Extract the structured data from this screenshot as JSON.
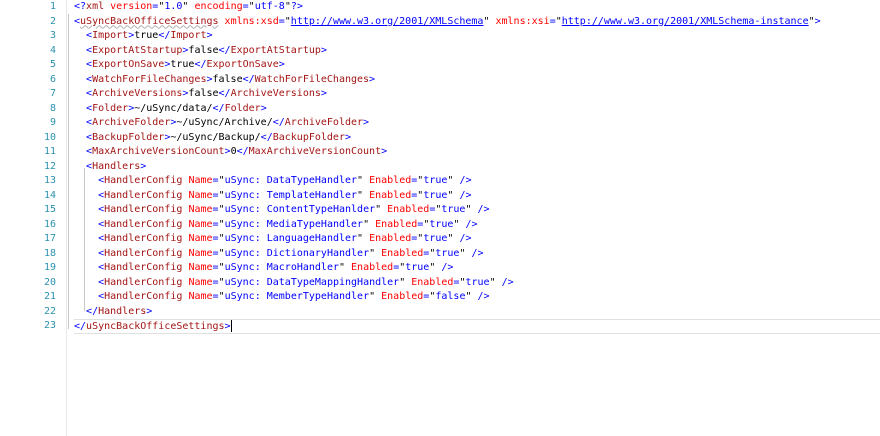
{
  "editor": {
    "line_numbers": [
      "1",
      "2",
      "3",
      "4",
      "5",
      "6",
      "7",
      "8",
      "9",
      "10",
      "11",
      "12",
      "13",
      "14",
      "15",
      "16",
      "17",
      "18",
      "19",
      "20",
      "21",
      "22",
      "23"
    ],
    "lines": [
      [
        {
          "c": "b",
          "t": "<?"
        },
        {
          "c": "n",
          "t": "xml"
        },
        {
          "c": "t",
          "t": " "
        },
        {
          "c": "a",
          "t": "version"
        },
        {
          "c": "b",
          "t": "="
        },
        {
          "c": "t",
          "t": "\""
        },
        {
          "c": "v",
          "t": "1.0"
        },
        {
          "c": "t",
          "t": "\" "
        },
        {
          "c": "a",
          "t": "encoding"
        },
        {
          "c": "b",
          "t": "="
        },
        {
          "c": "t",
          "t": "\""
        },
        {
          "c": "v",
          "t": "utf-8"
        },
        {
          "c": "t",
          "t": "\""
        },
        {
          "c": "b",
          "t": "?>"
        }
      ],
      [
        {
          "c": "b",
          "t": "<"
        },
        {
          "c": "n",
          "t": "uSyncBackOfficeSettings",
          "squig": true
        },
        {
          "c": "t",
          "t": " "
        },
        {
          "c": "a",
          "t": "xmlns:xsd"
        },
        {
          "c": "b",
          "t": "="
        },
        {
          "c": "t",
          "t": "\""
        },
        {
          "c": "u",
          "t": "http://www.w3.org/2001/XMLSchema"
        },
        {
          "c": "t",
          "t": "\" "
        },
        {
          "c": "a",
          "t": "xmlns:xsi"
        },
        {
          "c": "b",
          "t": "="
        },
        {
          "c": "t",
          "t": "\""
        },
        {
          "c": "u",
          "t": "http://www.w3.org/2001/XMLSchema-instance"
        },
        {
          "c": "t",
          "t": "\""
        },
        {
          "c": "b",
          "t": ">"
        }
      ],
      [
        {
          "c": "t",
          "t": "  "
        },
        {
          "c": "b",
          "t": "<"
        },
        {
          "c": "n",
          "t": "Import"
        },
        {
          "c": "b",
          "t": ">"
        },
        {
          "c": "t",
          "t": "true"
        },
        {
          "c": "b",
          "t": "</"
        },
        {
          "c": "n",
          "t": "Import"
        },
        {
          "c": "b",
          "t": ">"
        }
      ],
      [
        {
          "c": "t",
          "t": "  "
        },
        {
          "c": "b",
          "t": "<"
        },
        {
          "c": "n",
          "t": "ExportAtStartup"
        },
        {
          "c": "b",
          "t": ">"
        },
        {
          "c": "t",
          "t": "false"
        },
        {
          "c": "b",
          "t": "</"
        },
        {
          "c": "n",
          "t": "ExportAtStartup"
        },
        {
          "c": "b",
          "t": ">"
        }
      ],
      [
        {
          "c": "t",
          "t": "  "
        },
        {
          "c": "b",
          "t": "<"
        },
        {
          "c": "n",
          "t": "ExportOnSave"
        },
        {
          "c": "b",
          "t": ">"
        },
        {
          "c": "t",
          "t": "true"
        },
        {
          "c": "b",
          "t": "</"
        },
        {
          "c": "n",
          "t": "ExportOnSave"
        },
        {
          "c": "b",
          "t": ">"
        }
      ],
      [
        {
          "c": "t",
          "t": "  "
        },
        {
          "c": "b",
          "t": "<"
        },
        {
          "c": "n",
          "t": "WatchForFileChanges"
        },
        {
          "c": "b",
          "t": ">"
        },
        {
          "c": "t",
          "t": "false"
        },
        {
          "c": "b",
          "t": "</"
        },
        {
          "c": "n",
          "t": "WatchForFileChanges"
        },
        {
          "c": "b",
          "t": ">"
        }
      ],
      [
        {
          "c": "t",
          "t": "  "
        },
        {
          "c": "b",
          "t": "<"
        },
        {
          "c": "n",
          "t": "ArchiveVersions"
        },
        {
          "c": "b",
          "t": ">"
        },
        {
          "c": "t",
          "t": "false"
        },
        {
          "c": "b",
          "t": "</"
        },
        {
          "c": "n",
          "t": "ArchiveVersions"
        },
        {
          "c": "b",
          "t": ">"
        }
      ],
      [
        {
          "c": "t",
          "t": "  "
        },
        {
          "c": "b",
          "t": "<"
        },
        {
          "c": "n",
          "t": "Folder"
        },
        {
          "c": "b",
          "t": ">"
        },
        {
          "c": "t",
          "t": "~/uSync/data/"
        },
        {
          "c": "b",
          "t": "</"
        },
        {
          "c": "n",
          "t": "Folder"
        },
        {
          "c": "b",
          "t": ">"
        }
      ],
      [
        {
          "c": "t",
          "t": "  "
        },
        {
          "c": "b",
          "t": "<"
        },
        {
          "c": "n",
          "t": "ArchiveFolder"
        },
        {
          "c": "b",
          "t": ">"
        },
        {
          "c": "t",
          "t": "~/uSync/Archive/"
        },
        {
          "c": "b",
          "t": "</"
        },
        {
          "c": "n",
          "t": "ArchiveFolder"
        },
        {
          "c": "b",
          "t": ">"
        }
      ],
      [
        {
          "c": "t",
          "t": "  "
        },
        {
          "c": "b",
          "t": "<"
        },
        {
          "c": "n",
          "t": "BackupFolder"
        },
        {
          "c": "b",
          "t": ">"
        },
        {
          "c": "t",
          "t": "~/uSync/Backup/"
        },
        {
          "c": "b",
          "t": "</"
        },
        {
          "c": "n",
          "t": "BackupFolder"
        },
        {
          "c": "b",
          "t": ">"
        }
      ],
      [
        {
          "c": "t",
          "t": "  "
        },
        {
          "c": "b",
          "t": "<"
        },
        {
          "c": "n",
          "t": "MaxArchiveVersionCount"
        },
        {
          "c": "b",
          "t": ">"
        },
        {
          "c": "t",
          "t": "0"
        },
        {
          "c": "b",
          "t": "</"
        },
        {
          "c": "n",
          "t": "MaxArchiveVersionCount"
        },
        {
          "c": "b",
          "t": ">"
        }
      ],
      [
        {
          "c": "t",
          "t": "  "
        },
        {
          "c": "b",
          "t": "<"
        },
        {
          "c": "n",
          "t": "Handlers"
        },
        {
          "c": "b",
          "t": ">"
        }
      ],
      [
        {
          "c": "t",
          "t": "    "
        },
        {
          "c": "b",
          "t": "<"
        },
        {
          "c": "n",
          "t": "HandlerConfig"
        },
        {
          "c": "t",
          "t": " "
        },
        {
          "c": "a",
          "t": "Name"
        },
        {
          "c": "b",
          "t": "="
        },
        {
          "c": "t",
          "t": "\""
        },
        {
          "c": "v",
          "t": "uSync: DataTypeHandler"
        },
        {
          "c": "t",
          "t": "\" "
        },
        {
          "c": "a",
          "t": "Enabled"
        },
        {
          "c": "b",
          "t": "="
        },
        {
          "c": "t",
          "t": "\""
        },
        {
          "c": "v",
          "t": "true"
        },
        {
          "c": "t",
          "t": "\" "
        },
        {
          "c": "b",
          "t": "/>"
        }
      ],
      [
        {
          "c": "t",
          "t": "    "
        },
        {
          "c": "b",
          "t": "<"
        },
        {
          "c": "n",
          "t": "HandlerConfig"
        },
        {
          "c": "t",
          "t": " "
        },
        {
          "c": "a",
          "t": "Name"
        },
        {
          "c": "b",
          "t": "="
        },
        {
          "c": "t",
          "t": "\""
        },
        {
          "c": "v",
          "t": "uSync: TemplateHandler"
        },
        {
          "c": "t",
          "t": "\" "
        },
        {
          "c": "a",
          "t": "Enabled"
        },
        {
          "c": "b",
          "t": "="
        },
        {
          "c": "t",
          "t": "\""
        },
        {
          "c": "v",
          "t": "true"
        },
        {
          "c": "t",
          "t": "\" "
        },
        {
          "c": "b",
          "t": "/>"
        }
      ],
      [
        {
          "c": "t",
          "t": "    "
        },
        {
          "c": "b",
          "t": "<"
        },
        {
          "c": "n",
          "t": "HandlerConfig"
        },
        {
          "c": "t",
          "t": " "
        },
        {
          "c": "a",
          "t": "Name"
        },
        {
          "c": "b",
          "t": "="
        },
        {
          "c": "t",
          "t": "\""
        },
        {
          "c": "v",
          "t": "uSync: ContentTypeHanlder"
        },
        {
          "c": "t",
          "t": "\" "
        },
        {
          "c": "a",
          "t": "Enabled"
        },
        {
          "c": "b",
          "t": "="
        },
        {
          "c": "t",
          "t": "\""
        },
        {
          "c": "v",
          "t": "true"
        },
        {
          "c": "t",
          "t": "\" "
        },
        {
          "c": "b",
          "t": "/>"
        }
      ],
      [
        {
          "c": "t",
          "t": "    "
        },
        {
          "c": "b",
          "t": "<"
        },
        {
          "c": "n",
          "t": "HandlerConfig"
        },
        {
          "c": "t",
          "t": " "
        },
        {
          "c": "a",
          "t": "Name"
        },
        {
          "c": "b",
          "t": "="
        },
        {
          "c": "t",
          "t": "\""
        },
        {
          "c": "v",
          "t": "uSync: MediaTypeHandler"
        },
        {
          "c": "t",
          "t": "\" "
        },
        {
          "c": "a",
          "t": "Enabled"
        },
        {
          "c": "b",
          "t": "="
        },
        {
          "c": "t",
          "t": "\""
        },
        {
          "c": "v",
          "t": "true"
        },
        {
          "c": "t",
          "t": "\" "
        },
        {
          "c": "b",
          "t": "/>"
        }
      ],
      [
        {
          "c": "t",
          "t": "    "
        },
        {
          "c": "b",
          "t": "<"
        },
        {
          "c": "n",
          "t": "HandlerConfig"
        },
        {
          "c": "t",
          "t": " "
        },
        {
          "c": "a",
          "t": "Name"
        },
        {
          "c": "b",
          "t": "="
        },
        {
          "c": "t",
          "t": "\""
        },
        {
          "c": "v",
          "t": "uSync: LanguageHandler"
        },
        {
          "c": "t",
          "t": "\" "
        },
        {
          "c": "a",
          "t": "Enabled"
        },
        {
          "c": "b",
          "t": "="
        },
        {
          "c": "t",
          "t": "\""
        },
        {
          "c": "v",
          "t": "true"
        },
        {
          "c": "t",
          "t": "\" "
        },
        {
          "c": "b",
          "t": "/>"
        }
      ],
      [
        {
          "c": "t",
          "t": "    "
        },
        {
          "c": "b",
          "t": "<"
        },
        {
          "c": "n",
          "t": "HandlerConfig"
        },
        {
          "c": "t",
          "t": " "
        },
        {
          "c": "a",
          "t": "Name"
        },
        {
          "c": "b",
          "t": "="
        },
        {
          "c": "t",
          "t": "\""
        },
        {
          "c": "v",
          "t": "uSync: DictionaryHandler"
        },
        {
          "c": "t",
          "t": "\" "
        },
        {
          "c": "a",
          "t": "Enabled"
        },
        {
          "c": "b",
          "t": "="
        },
        {
          "c": "t",
          "t": "\""
        },
        {
          "c": "v",
          "t": "true"
        },
        {
          "c": "t",
          "t": "\" "
        },
        {
          "c": "b",
          "t": "/>"
        }
      ],
      [
        {
          "c": "t",
          "t": "    "
        },
        {
          "c": "b",
          "t": "<"
        },
        {
          "c": "n",
          "t": "HandlerConfig"
        },
        {
          "c": "t",
          "t": " "
        },
        {
          "c": "a",
          "t": "Name"
        },
        {
          "c": "b",
          "t": "="
        },
        {
          "c": "t",
          "t": "\""
        },
        {
          "c": "v",
          "t": "uSync: MacroHandler"
        },
        {
          "c": "t",
          "t": "\" "
        },
        {
          "c": "a",
          "t": "Enabled"
        },
        {
          "c": "b",
          "t": "="
        },
        {
          "c": "t",
          "t": "\""
        },
        {
          "c": "v",
          "t": "true"
        },
        {
          "c": "t",
          "t": "\" "
        },
        {
          "c": "b",
          "t": "/>"
        }
      ],
      [
        {
          "c": "t",
          "t": "    "
        },
        {
          "c": "b",
          "t": "<"
        },
        {
          "c": "n",
          "t": "HandlerConfig"
        },
        {
          "c": "t",
          "t": " "
        },
        {
          "c": "a",
          "t": "Name"
        },
        {
          "c": "b",
          "t": "="
        },
        {
          "c": "t",
          "t": "\""
        },
        {
          "c": "v",
          "t": "uSync: DataTypeMappingHandler"
        },
        {
          "c": "t",
          "t": "\" "
        },
        {
          "c": "a",
          "t": "Enabled"
        },
        {
          "c": "b",
          "t": "="
        },
        {
          "c": "t",
          "t": "\""
        },
        {
          "c": "v",
          "t": "true"
        },
        {
          "c": "t",
          "t": "\" "
        },
        {
          "c": "b",
          "t": "/>"
        }
      ],
      [
        {
          "c": "t",
          "t": "    "
        },
        {
          "c": "b",
          "t": "<"
        },
        {
          "c": "n",
          "t": "HandlerConfig"
        },
        {
          "c": "t",
          "t": " "
        },
        {
          "c": "a",
          "t": "Name"
        },
        {
          "c": "b",
          "t": "="
        },
        {
          "c": "t",
          "t": "\""
        },
        {
          "c": "v",
          "t": "uSync: MemberTypeHandler"
        },
        {
          "c": "t",
          "t": "\" "
        },
        {
          "c": "a",
          "t": "Enabled"
        },
        {
          "c": "b",
          "t": "="
        },
        {
          "c": "t",
          "t": "\""
        },
        {
          "c": "v",
          "t": "false"
        },
        {
          "c": "t",
          "t": "\" "
        },
        {
          "c": "b",
          "t": "/>"
        }
      ],
      [
        {
          "c": "t",
          "t": "  "
        },
        {
          "c": "b",
          "t": "</"
        },
        {
          "c": "n",
          "t": "Handlers"
        },
        {
          "c": "b",
          "t": ">"
        }
      ],
      [
        {
          "c": "b",
          "t": "</"
        },
        {
          "c": "n",
          "t": "uSyncBackOfficeSettings"
        },
        {
          "c": "b",
          "t": ">"
        }
      ]
    ],
    "current_line": 23,
    "colors": {
      "delimiter": "#0000ff",
      "element": "#a31515",
      "attribute": "#ff0000",
      "attr_value": "#0000ff",
      "text": "#000000",
      "line_number": "#2b91af"
    }
  }
}
